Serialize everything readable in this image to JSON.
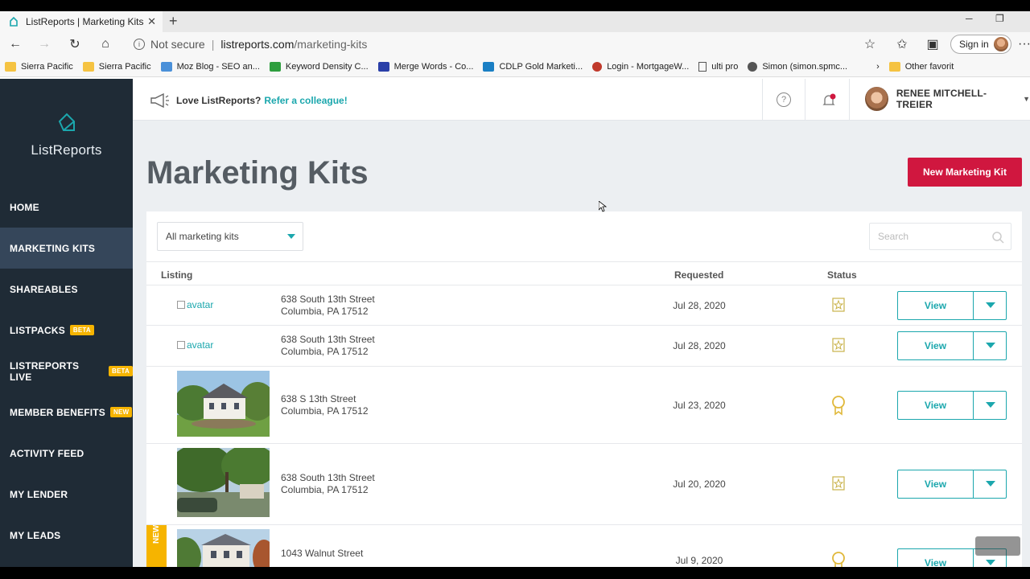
{
  "browser": {
    "tab_title": "ListReports | Marketing Kits",
    "tab_close": "✕",
    "new_tab": "+",
    "url_security": "Not secure",
    "url_separator": "|",
    "url_host": "listreports.com",
    "url_path": "/marketing-kits",
    "signin_label": "Sign in",
    "more": "···",
    "bookmarks": [
      {
        "label": "Sierra Pacific",
        "icon": "folder-icon"
      },
      {
        "label": "Sierra Pacific",
        "icon": "folder-icon"
      },
      {
        "label": "Moz Blog - SEO an...",
        "icon": "moz-icon"
      },
      {
        "label": "Keyword Density C...",
        "icon": "check-icon"
      },
      {
        "label": "Merge Words - Co...",
        "icon": "merge-icon"
      },
      {
        "label": "CDLP Gold Marketi...",
        "icon": "cdlp-icon"
      },
      {
        "label": "Login - MortgageW...",
        "icon": "power-icon"
      },
      {
        "label": "ulti pro",
        "icon": "page-icon"
      },
      {
        "label": "Simon (simon.spmc...",
        "icon": "simon-icon"
      }
    ],
    "bookmarks_more": "Other favorit"
  },
  "sidebar": {
    "brand": "ListReports",
    "items": [
      {
        "label": "HOME",
        "badge": ""
      },
      {
        "label": "MARKETING KITS",
        "badge": "",
        "active": true
      },
      {
        "label": "SHAREABLES",
        "badge": ""
      },
      {
        "label": "LISTPACKS",
        "badge": "BETA"
      },
      {
        "label": "LISTREPORTS LIVE",
        "badge": "BETA"
      },
      {
        "label": "MEMBER BENEFITS",
        "badge": "NEW"
      },
      {
        "label": "ACTIVITY FEED",
        "badge": ""
      },
      {
        "label": "MY LENDER",
        "badge": ""
      },
      {
        "label": "MY LEADS",
        "badge": ""
      }
    ]
  },
  "header": {
    "promo_text": "Love ListReports?",
    "promo_link": "Refer a colleague!",
    "help": "?",
    "user_name": "RENEE MITCHELL-TREIER"
  },
  "page": {
    "title": "Marketing Kits",
    "new_button": "New Marketing Kit",
    "filter_value": "All marketing kits",
    "search_placeholder": "Search",
    "columns": {
      "listing": "Listing",
      "requested": "Requested",
      "status": "Status"
    },
    "rows": [
      {
        "thumb": "avatar",
        "line1": "638 South 13th Street",
        "line2": "Columbia, PA 17512",
        "date": "Jul 28, 2020",
        "status": "star-badge-icon",
        "view": "View"
      },
      {
        "thumb": "avatar",
        "line1": "638 South 13th Street",
        "line2": "Columbia, PA 17512",
        "date": "Jul 28, 2020",
        "status": "star-badge-icon",
        "view": "View"
      },
      {
        "thumb": "photo",
        "line1": "638 S 13th Street",
        "line2": "Columbia, PA 17512",
        "date": "Jul 23, 2020",
        "status": "ribbon-icon",
        "view": "View"
      },
      {
        "thumb": "photo",
        "line1": "638 South 13th Street",
        "line2": "Columbia, PA 17512",
        "date": "Jul 20, 2020",
        "status": "star-badge-icon",
        "view": "View"
      },
      {
        "thumb": "photo",
        "line1": "1043 Walnut Street",
        "line2": "",
        "date": "Jul 9, 2020",
        "status": "ribbon-icon",
        "view": "View",
        "flag": "NEW"
      }
    ]
  },
  "colors": {
    "sidebar_bg": "#1f2b36",
    "accent": "#1ba7ad",
    "primary_button": "#d0173f",
    "badge": "#f6b400"
  }
}
